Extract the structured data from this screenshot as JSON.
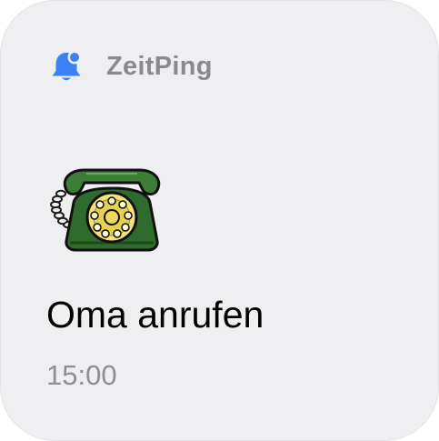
{
  "app": {
    "name": "ZeitPing",
    "icon": "bell-icon",
    "accent_color": "#3b82f6"
  },
  "reminder": {
    "icon": "telephone-icon",
    "title": "Oma anrufen",
    "time": "15:00"
  }
}
